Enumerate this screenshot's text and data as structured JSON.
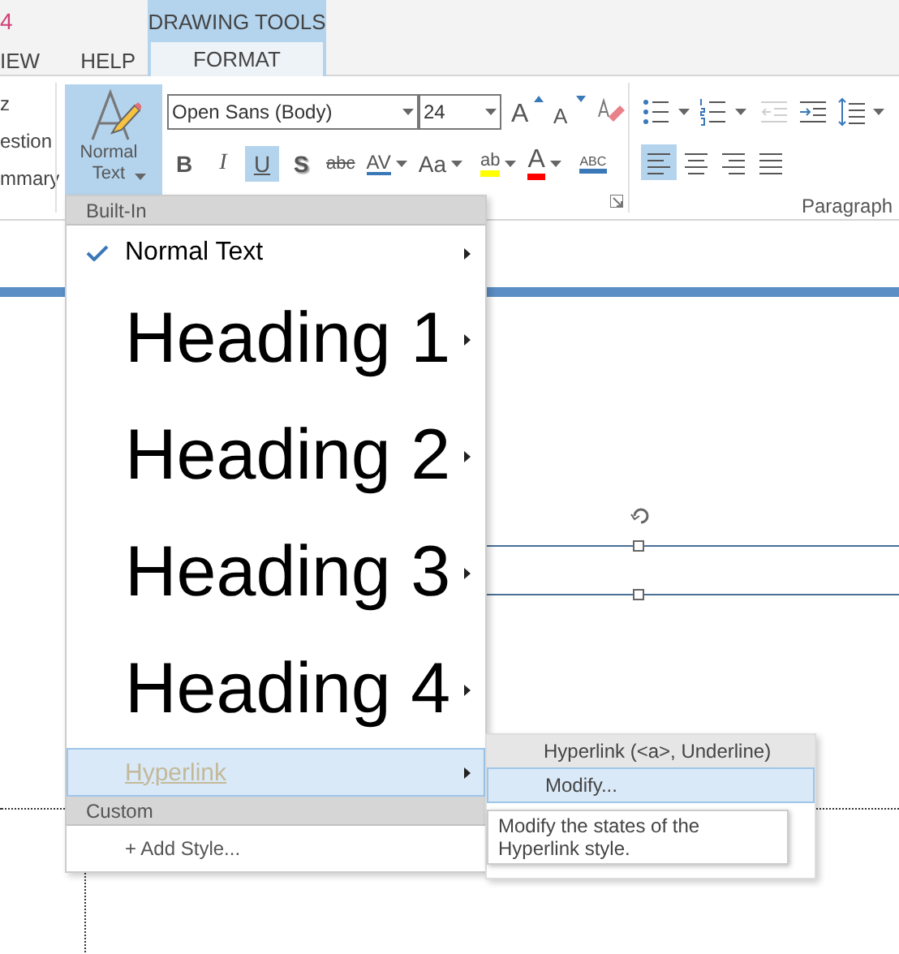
{
  "app_mark": "4",
  "tabs": [
    {
      "label": "IEW",
      "selected": false
    },
    {
      "label": "HELP",
      "selected": false
    }
  ],
  "contextual_group": {
    "title": "DRAWING TOOLS",
    "tabs": [
      {
        "label": "FORMAT",
        "selected": true
      }
    ]
  },
  "left_group_items": [
    "z",
    "estion",
    "mmary"
  ],
  "style_button": {
    "label": "Normal Text",
    "selected": true
  },
  "font": {
    "name": "Open Sans (Body)",
    "size": "24"
  },
  "font_size_buttons": [
    {
      "kind": "grow",
      "label": "A"
    },
    {
      "kind": "shrink",
      "label": "A"
    },
    {
      "kind": "clear"
    }
  ],
  "format_buttons": [
    {
      "kind": "bold",
      "label": "B",
      "selected": false
    },
    {
      "kind": "italic",
      "label": "I",
      "selected": false
    },
    {
      "kind": "underline",
      "label": "U",
      "selected": true
    },
    {
      "kind": "shadow",
      "label": "S",
      "selected": false
    },
    {
      "kind": "strike",
      "label": "abc",
      "selected": false
    },
    {
      "kind": "spacing",
      "label": "AV",
      "selected": false
    },
    {
      "kind": "case",
      "label": "Aa",
      "selected": false
    },
    {
      "kind": "highlight",
      "label": "ab",
      "selected": false
    },
    {
      "kind": "color",
      "label": "A",
      "selected": false
    },
    {
      "kind": "spell",
      "label": "ABC",
      "selected": false
    }
  ],
  "paragraph": {
    "title": "Paragraph",
    "list_buttons": [
      {
        "kind": "bullets",
        "disabled": false
      },
      {
        "kind": "numbering",
        "disabled": false
      },
      {
        "kind": "outdent",
        "disabled": true
      },
      {
        "kind": "indent",
        "disabled": false
      },
      {
        "kind": "spacing",
        "disabled": false
      }
    ],
    "align_buttons": [
      {
        "kind": "left",
        "selected": true
      },
      {
        "kind": "center",
        "selected": false
      },
      {
        "kind": "right",
        "selected": false
      },
      {
        "kind": "justify",
        "selected": false
      }
    ]
  },
  "styles_menu": {
    "sections": [
      {
        "header": "Built-In",
        "items": [
          {
            "label": "Normal Text",
            "kind": "normal",
            "checked": true,
            "selected": false
          },
          {
            "label": "Heading 1",
            "kind": "heading",
            "checked": false,
            "selected": false
          },
          {
            "label": "Heading 2",
            "kind": "heading",
            "checked": false,
            "selected": false
          },
          {
            "label": "Heading 3",
            "kind": "heading",
            "checked": false,
            "selected": false
          },
          {
            "label": "Heading 4",
            "kind": "heading",
            "checked": false,
            "selected": false
          },
          {
            "label": "Hyperlink",
            "kind": "hyperlink",
            "checked": false,
            "selected": true
          }
        ]
      },
      {
        "header": "Custom",
        "items": [
          {
            "label": "+ Add Style...",
            "kind": "action",
            "checked": false,
            "selected": false
          }
        ]
      }
    ]
  },
  "submenu": {
    "title": "Hyperlink (<a>, Underline)",
    "items": [
      {
        "label": "Modify...",
        "selected": true
      }
    ]
  },
  "tooltip": "Modify the states of the Hyperlink style."
}
